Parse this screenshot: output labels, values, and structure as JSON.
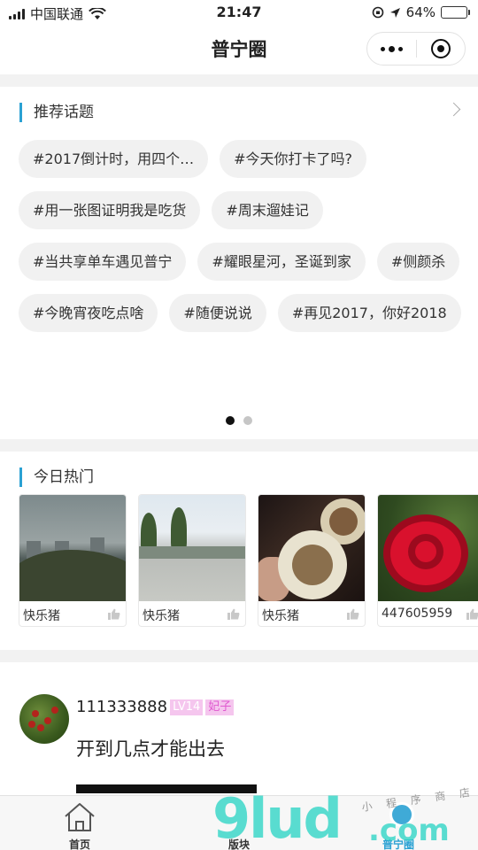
{
  "status_bar": {
    "carrier": "中国联通",
    "time": "21:47",
    "battery_percent": "64%",
    "battery_level": 0.64
  },
  "nav": {
    "title": "普宁圈"
  },
  "topics": {
    "title": "推荐话题",
    "tags": [
      "#2017倒计时，用四个…",
      "#今天你打卡了吗?",
      "#用一张图证明我是吃货",
      "#周末遛娃记",
      "#当共享单车遇见普宁",
      "#耀眼星河，圣诞到家",
      "#侧颜杀",
      "#今晚宵夜吃点啥",
      "#随便说说",
      "#再见2017，你好2018"
    ],
    "page_indicator": {
      "count": 2,
      "active": 1
    }
  },
  "hot": {
    "title": "今日热门",
    "items": [
      {
        "user": "快乐猪"
      },
      {
        "user": "快乐猪"
      },
      {
        "user": "快乐猪"
      },
      {
        "user": "447605959"
      }
    ]
  },
  "post": {
    "username": "111333888",
    "level_badge": "LV14",
    "title_badge": "妃子",
    "text": "开到几点才能出去"
  },
  "tabbar": {
    "tabs": [
      {
        "label": "首页"
      },
      {
        "label": "版块"
      },
      {
        "label": "普宁圈"
      }
    ]
  },
  "watermark": {
    "main": "9lud",
    "suffix": ".com",
    "sub": "小 程 序 商 店"
  },
  "colors": {
    "accent": "#2aa1d3",
    "battery": "#4cd964",
    "badge_bg": "#f5c6ee",
    "watermark": "#36d6c7"
  }
}
